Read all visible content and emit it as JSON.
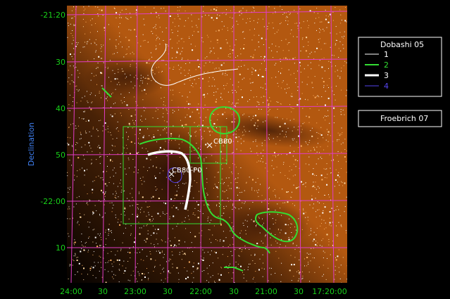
{
  "axes": {
    "ylabel": "Declination",
    "y_ticks": [
      "-21:20",
      "30",
      "40",
      "50",
      "-22:00",
      "10"
    ],
    "x_ticks": [
      "24:00",
      "30",
      "23:00",
      "30",
      "22:00",
      "30",
      "21:00",
      "30",
      "17:20:00"
    ]
  },
  "legend_dobashi": {
    "title": "Dobashi 05",
    "entries": [
      {
        "label": "1",
        "color": "#ffffff"
      },
      {
        "label": "2",
        "color": "#33dd33"
      },
      {
        "label": "3",
        "color": "#ffffff"
      },
      {
        "label": "4",
        "color": "#5544ee"
      }
    ]
  },
  "legend_froebrich": {
    "title": "Froebrich 07"
  },
  "sources": [
    {
      "label": "CB80"
    },
    {
      "label": "CB80-P0"
    }
  ],
  "colors": {
    "grid": "#e13cc6",
    "contour_green": "#33dd33",
    "contour_white": "#ffffff",
    "contour_blue": "#5544ee",
    "image_bg": "#b85a10"
  }
}
